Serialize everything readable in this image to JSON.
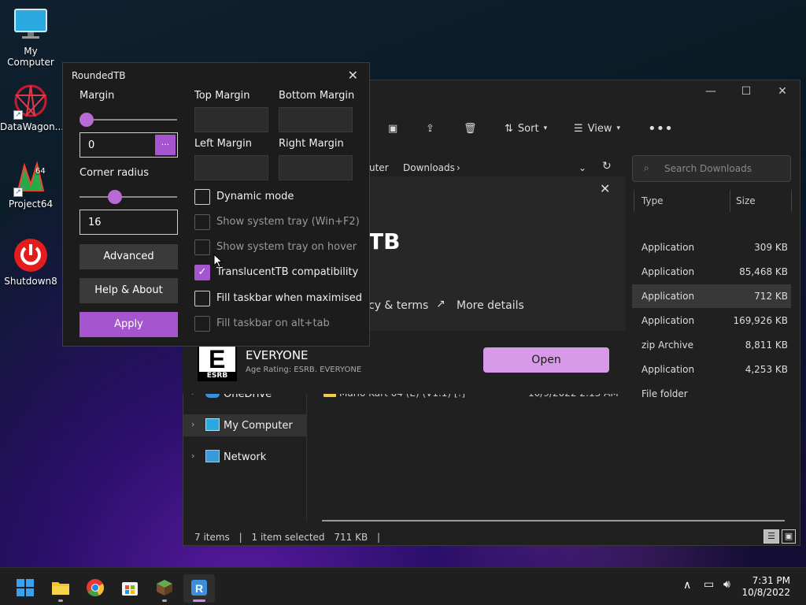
{
  "desktop": {
    "icons": [
      {
        "label": "My Computer"
      },
      {
        "label": "DataWagon..."
      },
      {
        "label": "Project64"
      },
      {
        "label": "Shutdown8"
      }
    ]
  },
  "explorer": {
    "toolbar": {
      "sort_label": "Sort",
      "view_label": "View"
    },
    "breadcrumb": {
      "part1": "uter",
      "part2": "Downloads"
    },
    "search_placeholder": "Search Downloads",
    "columns": {
      "type": "Type",
      "size": "Size"
    },
    "rows": [
      {
        "type": "Application",
        "size": "309 KB"
      },
      {
        "type": "Application",
        "size": "85,468 KB"
      },
      {
        "type": "Application",
        "size": "712 KB"
      },
      {
        "type": "Application",
        "size": "169,926 KB"
      },
      {
        "type": "zip Archive",
        "size": "8,811 KB"
      },
      {
        "type": "Application",
        "size": "4,253 KB"
      },
      {
        "type": "File folder",
        "size": ""
      }
    ],
    "folder_row": {
      "name": "Mario Kart 64 (E) (V1.1) [!]",
      "date": "10/9/2022 2:13 AM"
    },
    "nav": {
      "onedrive": "OneDrive",
      "my_computer": "My Computer",
      "network": "Network"
    },
    "status": {
      "items": "7 items",
      "selected": "1 item selected",
      "size": "711 KB"
    }
  },
  "store": {
    "title_fragment": "TB",
    "policy_link": "cy & terms",
    "more_details": "More details",
    "rating": "EVERYONE",
    "rating_detail": "Age Rating: ESRB. EVERYONE",
    "esrb_letter": "E",
    "esrb_brand": "ESRB",
    "open_label": "Open"
  },
  "roundedtb": {
    "title": "RoundedTB",
    "margin_label": "Margin",
    "margin_value": "0",
    "ellipsis": "...",
    "corner_label": "Corner radius",
    "corner_value": "16",
    "advanced": "Advanced",
    "help": "Help & About",
    "apply": "Apply",
    "top_margin": "Top Margin",
    "bottom_margin": "Bottom Margin",
    "left_margin": "Left Margin",
    "right_margin": "Right Margin",
    "options": [
      {
        "label": "Dynamic mode",
        "checked": false,
        "enabled": true
      },
      {
        "label": "Show system tray (Win+F2)",
        "checked": false,
        "enabled": false
      },
      {
        "label": "Show system tray on hover",
        "checked": false,
        "enabled": false
      },
      {
        "label": "TranslucentTB compatibility",
        "checked": true,
        "enabled": true
      },
      {
        "label": "Fill taskbar when maximised",
        "checked": false,
        "enabled": true
      },
      {
        "label": "Fill taskbar on alt+tab",
        "checked": false,
        "enabled": false
      }
    ]
  },
  "taskbar": {
    "time": "7:31 PM",
    "date": "10/8/2022",
    "apps": [
      "start-icon",
      "file-explorer-icon",
      "chrome-icon",
      "store-icon",
      "minecraft-icon",
      "roundedtb-icon"
    ]
  },
  "colors": {
    "accent": "#a556cf",
    "open_button": "#d89ae8"
  }
}
